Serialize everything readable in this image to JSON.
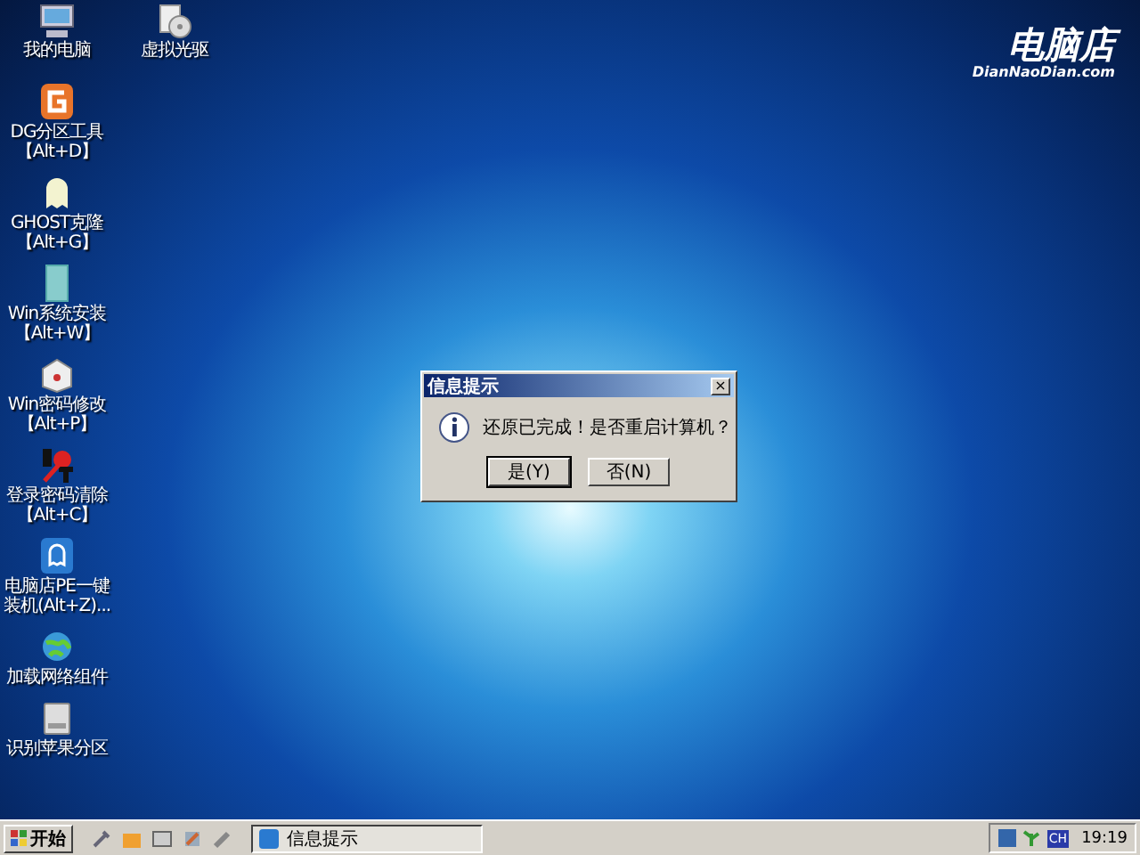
{
  "desktop": {
    "logo": {
      "title": "电脑店",
      "subtitle": "DianNaoDian.com"
    },
    "top_icons": [
      {
        "kind": "computer",
        "label": "我的电脑"
      },
      {
        "kind": "disc",
        "label": "虚拟光驱"
      }
    ],
    "icons": [
      {
        "kind": "dg",
        "label": "DG分区工具",
        "hotkey": "【Alt+D】"
      },
      {
        "kind": "ghost",
        "label": "GHOST克隆",
        "hotkey": "【Alt+G】"
      },
      {
        "kind": "install",
        "label": "Win系统安装",
        "hotkey": "【Alt+W】"
      },
      {
        "kind": "box",
        "label": "Win密码修改",
        "hotkey": "【Alt+P】"
      },
      {
        "kind": "nt",
        "label": "登录密码清除",
        "hotkey": "【Alt+C】"
      },
      {
        "kind": "pe",
        "label": "电脑店PE一键",
        "hotkey": "装机(Alt+Z)..."
      },
      {
        "kind": "globe",
        "label": "加载网络组件"
      },
      {
        "kind": "drive",
        "label": "识别苹果分区"
      }
    ]
  },
  "dialog": {
    "title": "信息提示",
    "close": "×",
    "message": "还原已完成！是否重启计算机？",
    "buttons": [
      {
        "label": "是(Y)",
        "focused": true
      },
      {
        "label": "否(N)",
        "focused": false
      }
    ]
  },
  "taskbar": {
    "start": "开始",
    "task": "信息提示",
    "tray": {
      "lang": "CH",
      "time": "19:19"
    }
  }
}
